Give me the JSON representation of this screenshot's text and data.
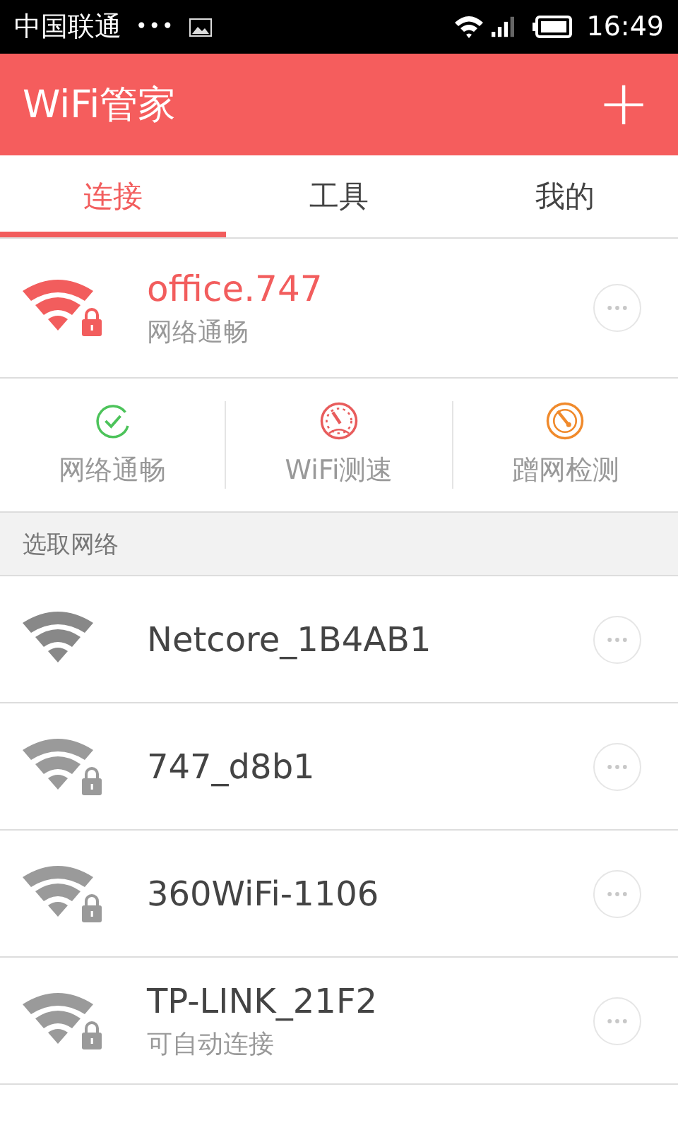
{
  "status_bar": {
    "carrier": "中国联通",
    "dots": "•••",
    "time": "16:49"
  },
  "app_bar": {
    "title": "WiFi管家",
    "add": "+"
  },
  "tabs": [
    {
      "label": "连接",
      "selected": true
    },
    {
      "label": "工具",
      "selected": false
    },
    {
      "label": "我的",
      "selected": false
    }
  ],
  "connected": {
    "name": "office.747",
    "status": "网络通畅",
    "locked": true
  },
  "actions": [
    {
      "kind": "check",
      "label": "网络通畅"
    },
    {
      "kind": "speed",
      "label": "WiFi测速"
    },
    {
      "kind": "guard",
      "label": "蹭网检测"
    }
  ],
  "section_title": "选取网络",
  "networks": [
    {
      "name": "Netcore_1B4AB1",
      "locked": false
    },
    {
      "name": "747_d8b1",
      "locked": true
    },
    {
      "name": "360WiFi-1106",
      "locked": true
    },
    {
      "name": "TP-LINK_21F2",
      "note": "可自动连接",
      "locked": true
    }
  ]
}
